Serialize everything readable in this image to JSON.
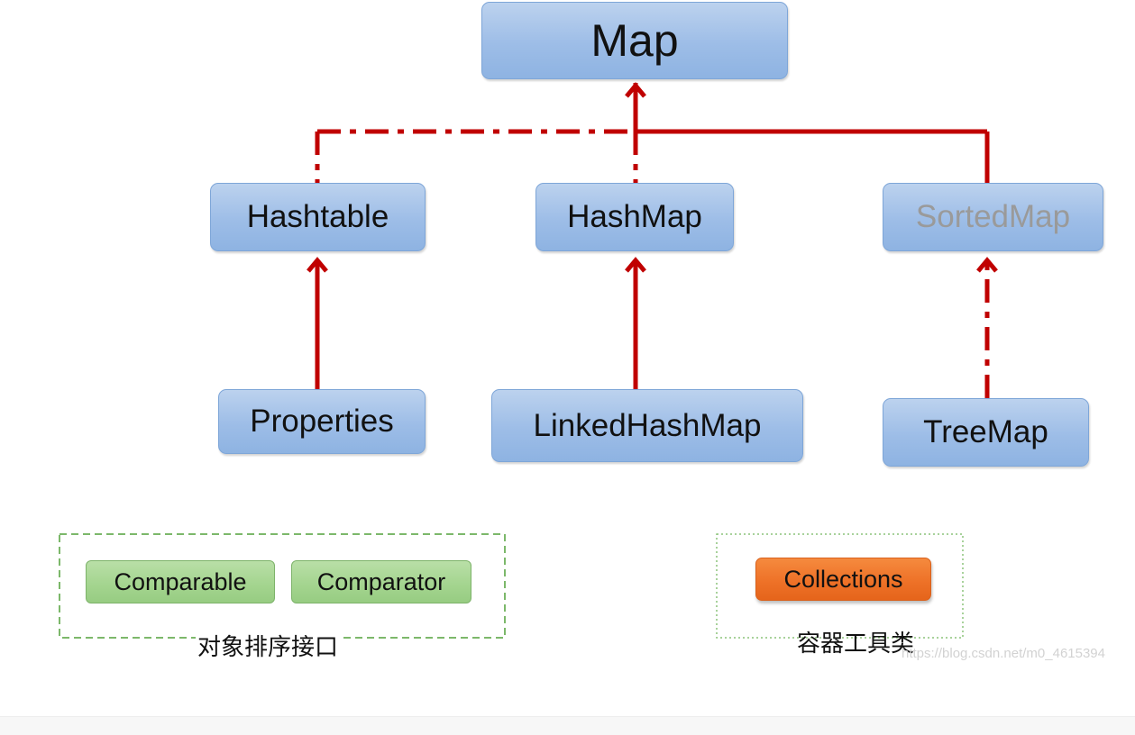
{
  "diagram": {
    "nodes": {
      "map": "Map",
      "hashtable": "Hashtable",
      "hashmap": "HashMap",
      "sortedmap": "SortedMap",
      "properties": "Properties",
      "linkedhashmap": "LinkedHashMap",
      "treemap": "TreeMap"
    },
    "edges": [
      {
        "from": "Hashtable",
        "to": "Map",
        "style": "dash-dot"
      },
      {
        "from": "HashMap",
        "to": "Map",
        "style": "dash-dot"
      },
      {
        "from": "SortedMap",
        "to": "Map",
        "style": "solid"
      },
      {
        "from": "Properties",
        "to": "Hashtable",
        "style": "solid"
      },
      {
        "from": "LinkedHashMap",
        "to": "HashMap",
        "style": "solid"
      },
      {
        "from": "TreeMap",
        "to": "SortedMap",
        "style": "dash-dot"
      }
    ],
    "sorting_group": {
      "items": [
        "Comparable",
        "Comparator"
      ],
      "caption": "对象排序接口"
    },
    "tools_group": {
      "item": "Collections",
      "caption": "容器工具类"
    },
    "watermark": "https://blog.csdn.net/m0_4615394"
  },
  "colors": {
    "edge": "#c00000",
    "node_blue": "#9dbde7",
    "node_green": "#a3d48e",
    "node_orange": "#ee7228",
    "muted_text": "#9a9a9a"
  }
}
